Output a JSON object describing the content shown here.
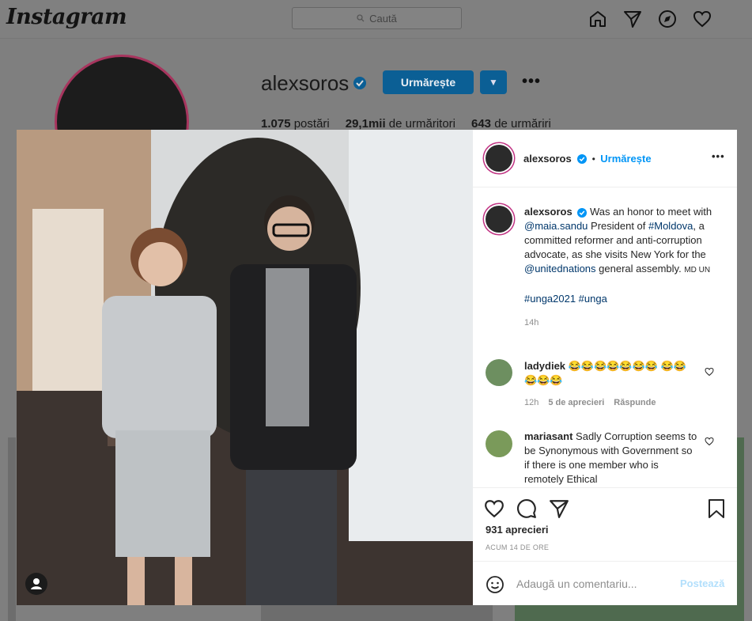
{
  "header": {
    "logo": "Instagram",
    "search_placeholder": "Caută",
    "icons": [
      "home-icon",
      "direct-icon",
      "explore-icon",
      "activity-heart-icon"
    ]
  },
  "profile": {
    "username": "alexsoros",
    "follow_label": "Urmărește",
    "stats": {
      "posts_value": "1.075",
      "posts_label": "postări",
      "followers_value": "29,1mii",
      "followers_label": "de urmăritori",
      "following_value": "643",
      "following_label": "de urmăriri"
    }
  },
  "post": {
    "username": "alexsoros",
    "separator": "•",
    "follow_label": "Urmărește",
    "caption": {
      "username": "alexsoros",
      "t1": "Was an honor to meet with ",
      "mention1": "@maia.sandu",
      "t2": " President of ",
      "hashtag1": "#Moldova",
      "t3": ", a committed reformer and anti-corruption advocate, as she visits New York for the ",
      "mention2": "@unitednations",
      "t4": " general assembly. ",
      "flags": "MD UN",
      "hashtags": "#unga2021 #unga",
      "time": "14h"
    },
    "comments": [
      {
        "username": "ladydiek",
        "text": "😂😂😂😂😂😂😂 😂😂😂😂😂",
        "time": "12h",
        "date": "5 de aprecieri",
        "reply": "Răspunde"
      },
      {
        "username": "mariasant",
        "text": "Sadly Corruption seems to be Synonymous with Government so if there is one member who is remotely Ethical"
      }
    ],
    "likes": "931 aprecieri",
    "time_ago": "ACUM 14 DE ORE",
    "add_comment_placeholder": "Adaugă un comentariu...",
    "post_button": "Postează"
  },
  "colors": {
    "accent": "#0095f6",
    "link": "#00376b",
    "follow_dimmed": "#0b5f95"
  }
}
